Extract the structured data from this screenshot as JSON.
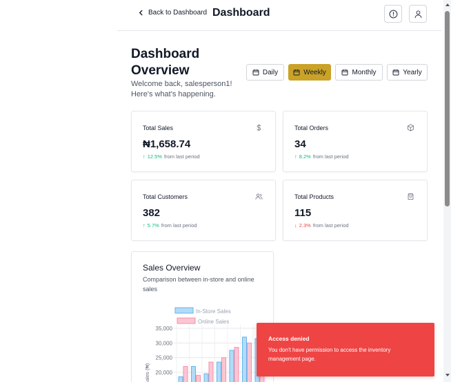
{
  "header": {
    "back_label": "Back to Dashboard",
    "title": "Dashboard"
  },
  "overview": {
    "title": "Dashboard Overview",
    "welcome": "Welcome back, salesperson1! Here's what's happening."
  },
  "periods": [
    {
      "label": "Daily",
      "active": false
    },
    {
      "label": "Weekly",
      "active": true
    },
    {
      "label": "Monthly",
      "active": false
    },
    {
      "label": "Yearly",
      "active": false
    }
  ],
  "stats": [
    {
      "label": "Total Sales",
      "value": "₦1,658.74",
      "change": "12.5%",
      "suffix": "from last period",
      "trend": "up",
      "icon": "dollar-icon"
    },
    {
      "label": "Total Orders",
      "value": "34",
      "change": "8.2%",
      "suffix": "from last period",
      "trend": "up",
      "icon": "box-icon"
    },
    {
      "label": "Total Customers",
      "value": "382",
      "change": "5.7%",
      "suffix": "from last period",
      "trend": "up",
      "icon": "users-icon"
    },
    {
      "label": "Total Products",
      "value": "115",
      "change": "2.3%",
      "suffix": "from last period",
      "trend": "down",
      "icon": "bag-icon"
    }
  ],
  "sales_overview": {
    "title": "Sales Overview",
    "subtitle": "Comparison between in-store and online sales"
  },
  "chart_data": {
    "type": "bar",
    "series": [
      {
        "name": "In-Store Sales",
        "color": "#60b4f0",
        "values": [
          18500,
          22000,
          19500,
          23500,
          27500,
          32000,
          31500
        ]
      },
      {
        "name": "Online Sales",
        "color": "#f78fa7",
        "values": [
          22000,
          19000,
          23500,
          25000,
          28500,
          30000,
          28000
        ]
      }
    ],
    "yticks": [
      "35,000",
      "30,000",
      "25,000",
      "20,000"
    ],
    "ylabel": "Sales (₦)",
    "ylim": [
      0,
      37000
    ]
  },
  "toast": {
    "title": "Access denied",
    "message": "You don't have permission to access the inventory management page.",
    "color": "#ef4444"
  },
  "colors": {
    "accent": "#c9a227",
    "up": "#10b981",
    "down": "#ef4444"
  }
}
